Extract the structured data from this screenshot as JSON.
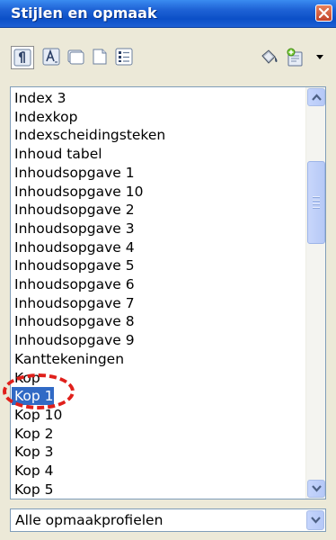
{
  "window": {
    "title": "Stijlen en opmaak"
  },
  "toolbar": {
    "buttons": [
      {
        "icon": "paragraph-styles-icon",
        "active": true
      },
      {
        "icon": "character-styles-icon",
        "active": false
      },
      {
        "icon": "frame-styles-icon",
        "active": false
      },
      {
        "icon": "page-styles-icon",
        "active": false
      },
      {
        "icon": "list-styles-icon",
        "active": false
      }
    ],
    "right_buttons": [
      {
        "icon": "fill-format-mode-icon"
      },
      {
        "icon": "new-style-from-selection-icon"
      }
    ]
  },
  "styles_list": {
    "items": [
      "Index 3",
      "Indexkop",
      "Indexscheidingsteken",
      "Inhoud tabel",
      "Inhoudsopgave 1",
      "Inhoudsopgave 10",
      "Inhoudsopgave 2",
      "Inhoudsopgave 3",
      "Inhoudsopgave 4",
      "Inhoudsopgave 5",
      "Inhoudsopgave 6",
      "Inhoudsopgave 7",
      "Inhoudsopgave 8",
      "Inhoudsopgave 9",
      "Kanttekeningen",
      "Kop",
      "Kop 1",
      "Kop 10",
      "Kop 2",
      "Kop 3",
      "Kop 4",
      "Kop 5"
    ],
    "selected_index": 16
  },
  "filter": {
    "value": "Alle opmaakprofielen"
  },
  "colors": {
    "titlebar": "#0b4fc7",
    "selection": "#316ac5",
    "highlight_annotation": "#e0201b"
  }
}
